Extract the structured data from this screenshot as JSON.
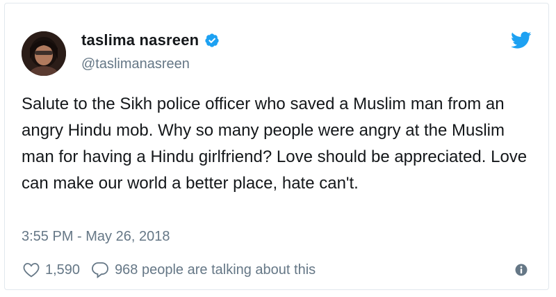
{
  "user": {
    "display_name": "taslima nasreen",
    "handle": "@taslimanasreen",
    "verified": true
  },
  "tweet": {
    "text": "Salute to the Sikh police officer who saved a Muslim man from an angry Hindu mob. Why so many people were angry at the Muslim man for having a Hindu girlfriend? Love should be appreciated. Love can make our world a better place, hate can't.",
    "timestamp": "3:55 PM - May 26, 2018"
  },
  "stats": {
    "likes": "1,590",
    "replies_text": "968 people are talking about this"
  },
  "icons": {
    "like": "heart-icon",
    "reply": "speech-bubble-icon",
    "info": "info-icon",
    "brand": "twitter-bird-icon",
    "verified": "verified-badge-icon"
  },
  "colors": {
    "brand_blue": "#1da1f2",
    "text_primary": "#14171a",
    "text_secondary": "#657786",
    "border": "#e1e8ed"
  }
}
